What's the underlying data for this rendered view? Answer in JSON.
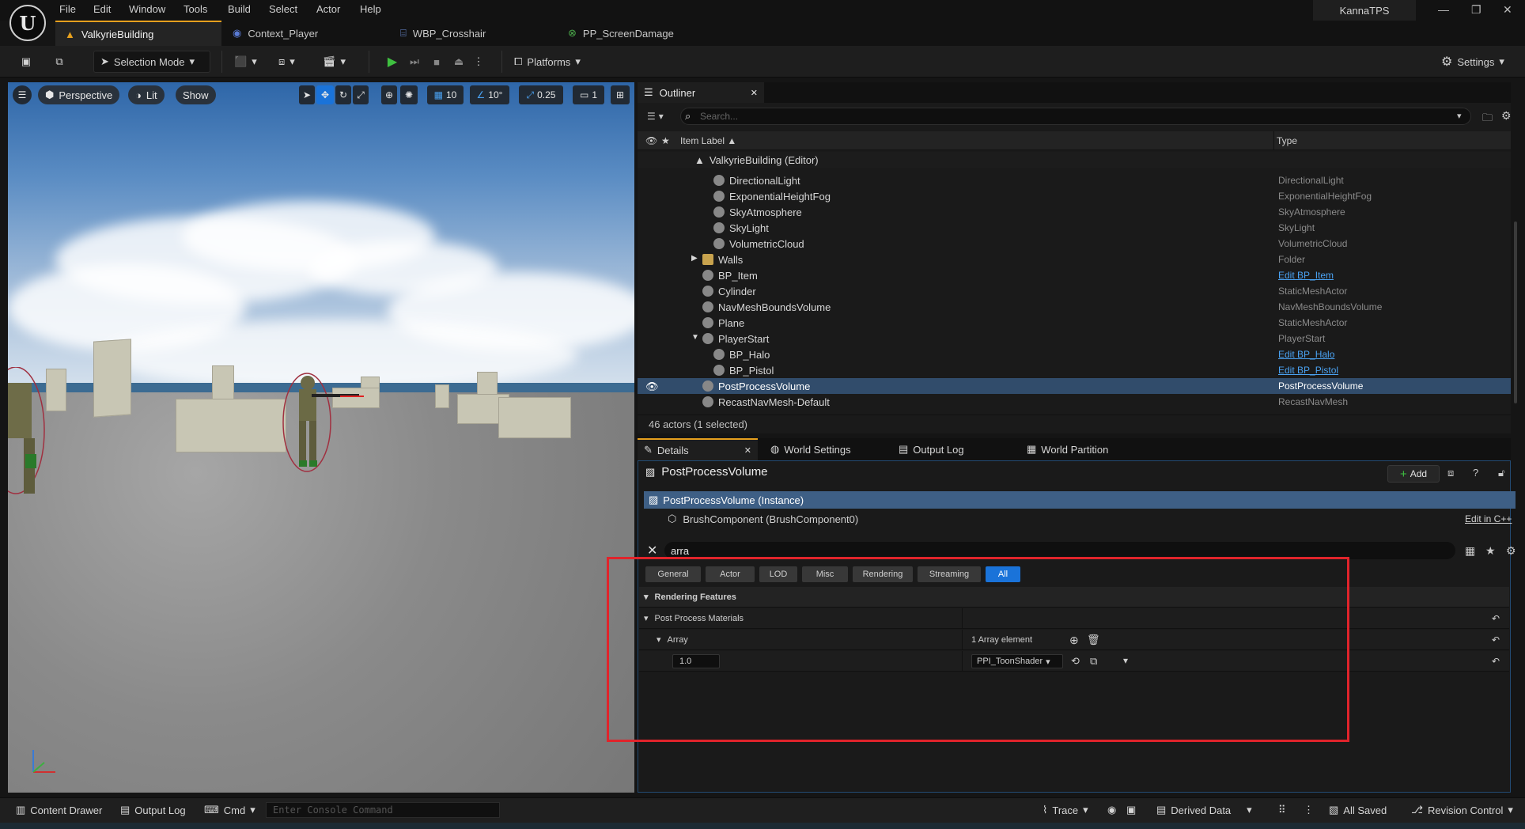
{
  "app": {
    "project_name": "KannaTPS"
  },
  "menu": [
    "File",
    "Edit",
    "Window",
    "Tools",
    "Build",
    "Select",
    "Actor",
    "Help"
  ],
  "document_tabs": [
    {
      "label": "ValkyrieBuilding",
      "active": true
    },
    {
      "label": "Context_Player",
      "active": false
    },
    {
      "label": "WBP_Crosshair",
      "active": false
    },
    {
      "label": "PP_ScreenDamage",
      "active": false
    }
  ],
  "toolbar": {
    "selection_mode": "Selection Mode",
    "platforms": "Platforms",
    "settings": "Settings"
  },
  "viewport": {
    "perspective": "Perspective",
    "lit": "Lit",
    "show": "Show",
    "grid_snap": "10",
    "rotation_snap": "10°",
    "scale_snap": "0.25",
    "camera_speed": "1"
  },
  "outliner": {
    "tab_label": "Outliner",
    "search_placeholder": "Search...",
    "col_label": "Item Label ▲",
    "col_type": "Type",
    "world_label": "ValkyrieBuilding (Editor)",
    "rows": [
      {
        "label": "DirectionalLight",
        "type": "DirectionalLight",
        "link": false,
        "indent": 2
      },
      {
        "label": "ExponentialHeightFog",
        "type": "ExponentialHeightFog",
        "link": false,
        "indent": 2
      },
      {
        "label": "SkyAtmosphere",
        "type": "SkyAtmosphere",
        "link": false,
        "indent": 2
      },
      {
        "label": "SkyLight",
        "type": "SkyLight",
        "link": false,
        "indent": 2
      },
      {
        "label": "VolumetricCloud",
        "type": "VolumetricCloud",
        "link": false,
        "indent": 2
      },
      {
        "label": "Walls",
        "type": "Folder",
        "link": false,
        "indent": 1
      },
      {
        "label": "BP_Item",
        "type": "Edit BP_Item",
        "link": true,
        "indent": 1
      },
      {
        "label": "Cylinder",
        "type": "StaticMeshActor",
        "link": false,
        "indent": 1
      },
      {
        "label": "NavMeshBoundsVolume",
        "type": "NavMeshBoundsVolume",
        "link": false,
        "indent": 1
      },
      {
        "label": "Plane",
        "type": "StaticMeshActor",
        "link": false,
        "indent": 1
      },
      {
        "label": "PlayerStart",
        "type": "PlayerStart",
        "link": false,
        "indent": 1
      },
      {
        "label": "BP_Halo",
        "type": "Edit BP_Halo",
        "link": true,
        "indent": 2
      },
      {
        "label": "BP_Pistol",
        "type": "Edit BP_Pistol",
        "link": true,
        "indent": 2
      },
      {
        "label": "PostProcessVolume",
        "type": "PostProcessVolume",
        "link": false,
        "indent": 1,
        "selected": true
      },
      {
        "label": "RecastNavMesh-Default",
        "type": "RecastNavMesh",
        "link": false,
        "indent": 1
      }
    ],
    "status": "46 actors (1 selected)"
  },
  "details_tabs": [
    "Details",
    "World Settings",
    "Output Log",
    "World Partition"
  ],
  "details": {
    "actor_name": "PostProcessVolume",
    "add_label": "Add",
    "instance_label": "PostProcessVolume (Instance)",
    "component_label": "BrushComponent (BrushComponent0)",
    "edit_cpp": "Edit in C++",
    "search_value": "arra",
    "filters": [
      {
        "label": "General",
        "on": false
      },
      {
        "label": "Actor",
        "on": false
      },
      {
        "label": "LOD",
        "on": false
      },
      {
        "label": "Misc",
        "on": false
      },
      {
        "label": "Rendering",
        "on": false
      },
      {
        "label": "Streaming",
        "on": false
      },
      {
        "label": "All",
        "on": true
      }
    ],
    "section": "Rendering Features",
    "property": "Post Process Materials",
    "array_label": "Array",
    "array_count": "1 Array element",
    "weight": "1.0",
    "material": "PPI_ToonShader"
  },
  "bottom": {
    "content_drawer": "Content Drawer",
    "output_log": "Output Log",
    "cmd": "Cmd",
    "console_placeholder": "Enter Console Command",
    "trace": "Trace",
    "derived_data": "Derived Data",
    "all_saved": "All Saved",
    "revision_control": "Revision Control"
  },
  "colors": {
    "accent": "#e6a01e",
    "selection": "#314c6b",
    "link": "#4aa2f2",
    "highlight_box": "#e0242b",
    "filter_on": "#1a73d9"
  }
}
